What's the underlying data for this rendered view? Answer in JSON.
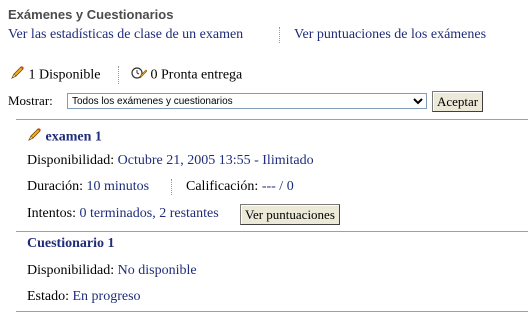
{
  "header": {
    "title": "Exámenes y Cuestionarios",
    "link_stats": "Ver las estadísticas de clase de un examen",
    "link_scores": "Ver puntuaciones de los exámenes"
  },
  "status": {
    "available_count": "1",
    "available_label": "Disponible",
    "due_count": "0",
    "due_label": "Pronta entrega"
  },
  "filter": {
    "label": "Mostrar:",
    "selected": "Todos los exámenes y cuestionarios",
    "button": "Aceptar"
  },
  "items": [
    {
      "title": "examen 1",
      "availability_label": "Disponibilidad:",
      "availability_value": "Octubre 21, 2005 13:55 - Ilimitado",
      "duration_label": "Duración:",
      "duration_value": "10 minutos",
      "grade_label": "Calificación:",
      "grade_value": "--- / 0",
      "attempts_label": "Intentos:",
      "attempts_value": "0 terminados, 2 restantes",
      "scores_button": "Ver puntuaciones"
    },
    {
      "title": "Cuestionario 1",
      "availability_label": "Disponibilidad:",
      "availability_value": "No disponible",
      "state_label": "Estado:",
      "state_value": "En progreso"
    }
  ],
  "colors": {
    "link": "#1f2d7a",
    "title": "#4c4c4c",
    "button_bg": "#ece9d8"
  }
}
